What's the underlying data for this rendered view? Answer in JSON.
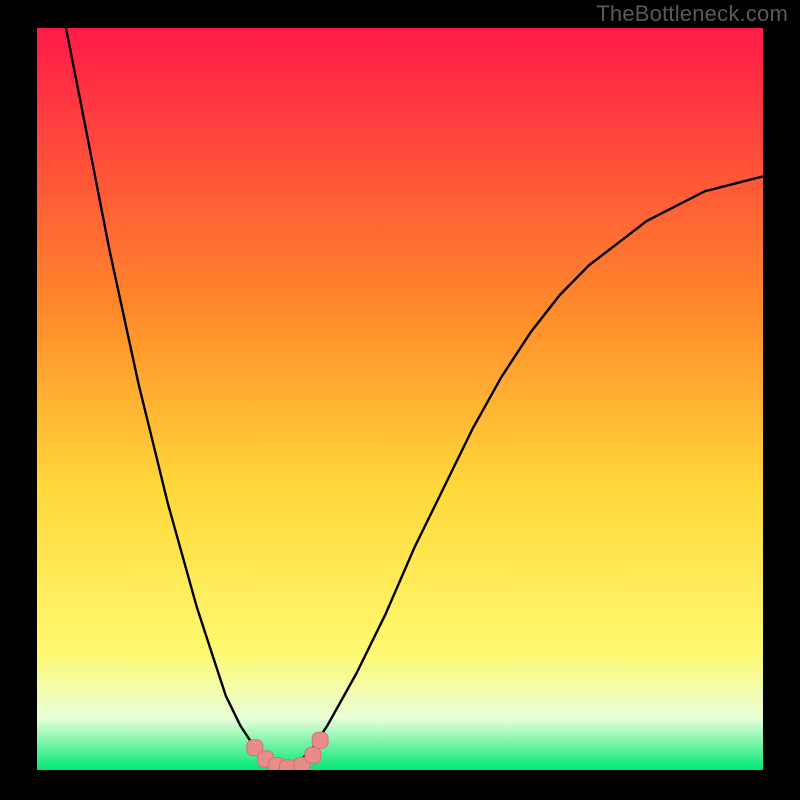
{
  "watermark_text": "TheBottleneck.com",
  "colors": {
    "frame": "#000000",
    "watermark": "#5a5a5a",
    "curve": "#000000",
    "marker_fill": "#e88b8b",
    "marker_stroke": "#d86f6f",
    "gradient_top": "#ff1a48",
    "gradient_mid1": "#ff8a2a",
    "gradient_mid2": "#ffd83a",
    "gradient_mid3": "#fff970",
    "gradient_mid4": "#e9ffd8",
    "gradient_bottom": "#00e874"
  },
  "chart_data": {
    "type": "line",
    "title": "",
    "xlabel": "",
    "ylabel": "",
    "xlim": [
      0,
      100
    ],
    "ylim": [
      0,
      100
    ],
    "grid": false,
    "legend": false,
    "series": [
      {
        "name": "bottleneck-curve",
        "x": [
          4,
          6,
          8,
          10,
          12,
          14,
          16,
          18,
          20,
          22,
          24,
          26,
          28,
          30,
          32,
          34,
          36,
          38,
          40,
          44,
          48,
          52,
          56,
          60,
          64,
          68,
          72,
          76,
          80,
          84,
          88,
          92,
          96,
          100
        ],
        "y": [
          100,
          90,
          80,
          70,
          61,
          52,
          44,
          36,
          29,
          22,
          16,
          10,
          6,
          3,
          1,
          0.5,
          1,
          3,
          6,
          13,
          21,
          30,
          38,
          46,
          53,
          59,
          64,
          68,
          71,
          74,
          76,
          78,
          79,
          80
        ]
      }
    ],
    "markers": {
      "name": "highlight-points",
      "points": [
        {
          "x": 30,
          "y": 3
        },
        {
          "x": 31.5,
          "y": 1.5
        },
        {
          "x": 33,
          "y": 0.6
        },
        {
          "x": 34.5,
          "y": 0.3
        },
        {
          "x": 36.5,
          "y": 0.6
        },
        {
          "x": 38,
          "y": 2
        },
        {
          "x": 39,
          "y": 4
        }
      ]
    }
  }
}
